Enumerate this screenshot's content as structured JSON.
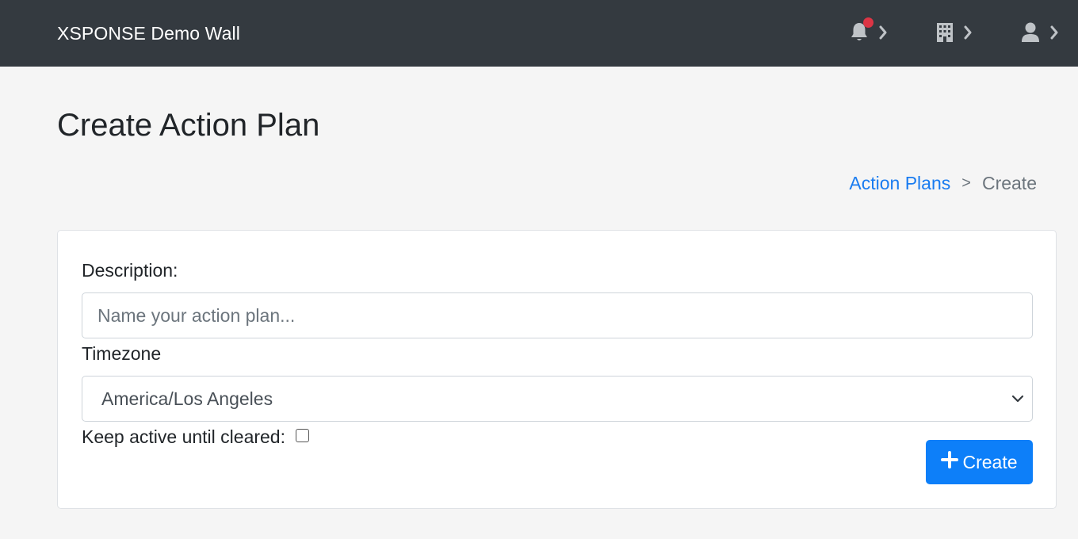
{
  "navbar": {
    "brand": "XSPONSE Demo Wall",
    "icons": [
      "bell-icon",
      "building-icon",
      "user-icon",
      "chevron-right-icon"
    ],
    "notification_dot_color": "#dc3545"
  },
  "page": {
    "title": "Create Action Plan"
  },
  "breadcrumb": {
    "link": "Action Plans",
    "separator": ">",
    "current": "Create"
  },
  "form": {
    "description_label": "Description:",
    "description_placeholder": "Name your action plan...",
    "description_value": "",
    "timezone_label": "Timezone",
    "timezone_selected": "America/Los Angeles",
    "keep_active_label": "Keep active until cleared:",
    "keep_active_checked": false,
    "create_button_label": "Create"
  },
  "colors": {
    "navbar_bg": "#343a40",
    "primary": "#0d7ff9",
    "link": "#1a7cf0",
    "page_bg": "#f5f5f5"
  }
}
